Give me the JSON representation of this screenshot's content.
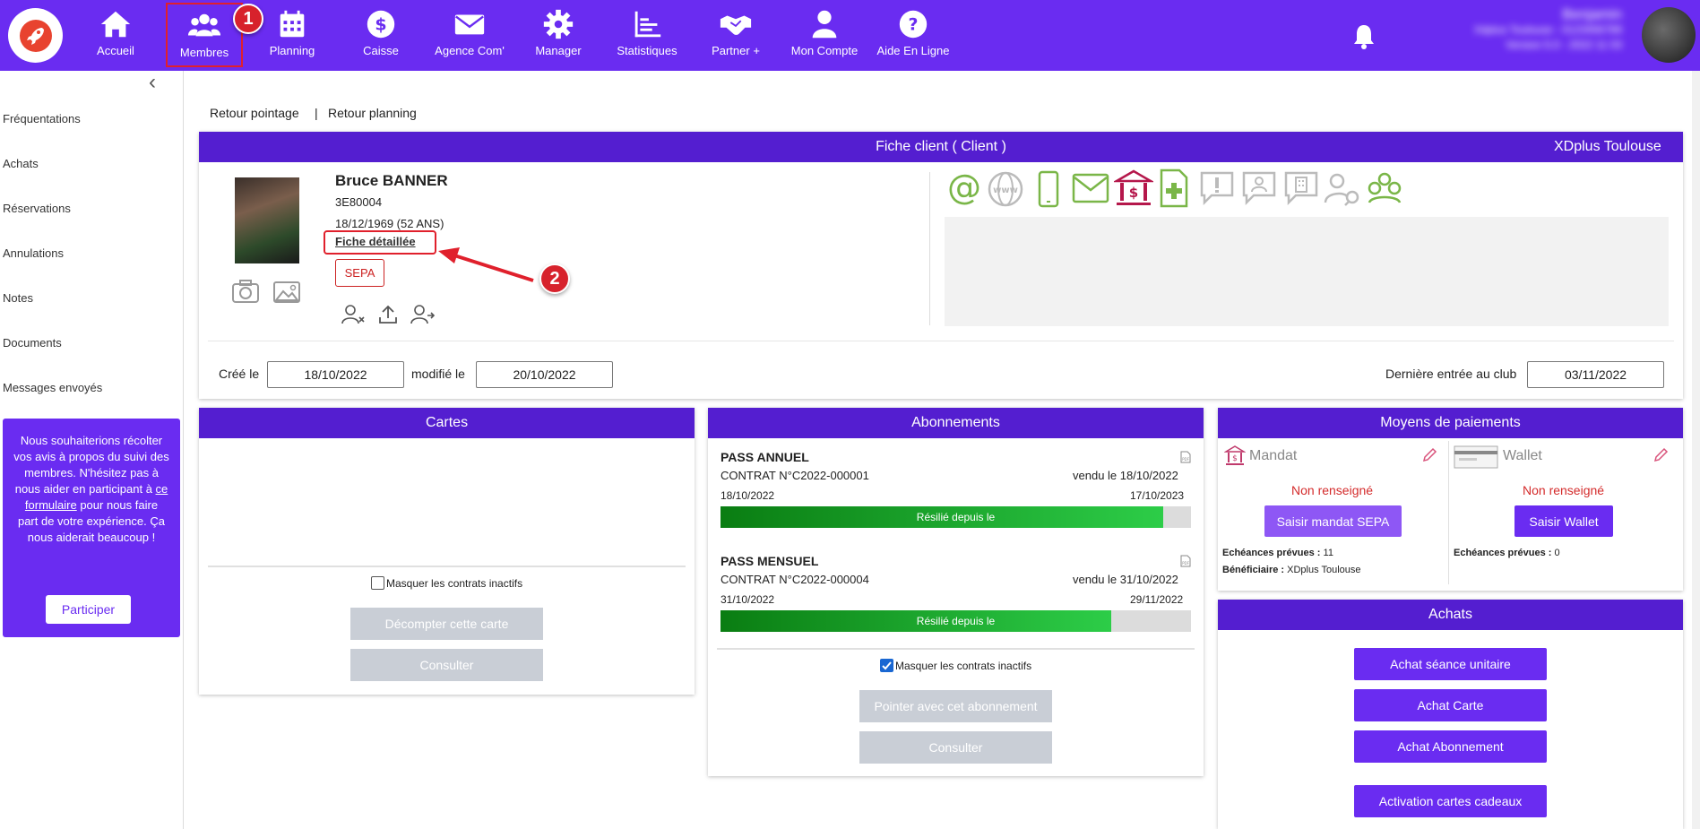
{
  "nav": {
    "items": [
      {
        "label": "Accueil",
        "icon": "home-icon"
      },
      {
        "label": "Membres",
        "icon": "users-icon"
      },
      {
        "label": "Planning",
        "icon": "calendar-icon"
      },
      {
        "label": "Caisse",
        "icon": "dollar-icon"
      },
      {
        "label": "Agence Com'",
        "icon": "envelope-icon"
      },
      {
        "label": "Manager",
        "icon": "gear-icon"
      },
      {
        "label": "Statistiques",
        "icon": "chart-icon"
      },
      {
        "label": "Partner +",
        "icon": "handshake-icon"
      },
      {
        "label": "Mon Compte",
        "icon": "user-icon"
      },
      {
        "label": "Aide En Ligne",
        "icon": "help-icon"
      }
    ],
    "badge1": "1",
    "badge2": "2"
  },
  "user": {
    "name": "Benjamin",
    "line2": "Xdplus Toulouse - 0123456789",
    "line3": "Version 5.0 - 2022 11 03"
  },
  "sidebar": {
    "items": [
      "Fréquentations",
      "Achats",
      "Réservations",
      "Annulations",
      "Notes",
      "Documents",
      "Messages envoyés"
    ],
    "feedback_pre": "Nous souhaiterions récolter vos avis à propos du suivi des membres. N'hésitez pas à nous aider en participant à ",
    "feedback_link": "ce formulaire",
    "feedback_post": " pour nous faire part de votre expérience. Ça nous aiderait beaucoup !",
    "participer": "Participer"
  },
  "links": {
    "retour_pointage": "Retour pointage",
    "sep": "|",
    "retour_planning": "Retour planning"
  },
  "fiche": {
    "title": "Fiche client ( Client )",
    "club": "XDplus Toulouse",
    "name": "Bruce BANNER",
    "id": "3E80004",
    "birth": "18/12/1969 (52 ANS)",
    "detail_link": "Fiche détaillée",
    "sepa": "SEPA",
    "created_label": "Créé le",
    "created": "18/10/2022",
    "modified_label": "modifié le",
    "modified": "20/10/2022",
    "last_entry_label": "Dernière entrée au club",
    "last_entry": "03/11/2022"
  },
  "cartes": {
    "title": "Cartes",
    "mask": "Masquer les contrats inactifs",
    "decompter": "Décompter cette carte",
    "consulter": "Consulter"
  },
  "abonnements": {
    "title": "Abonnements",
    "items": [
      {
        "name": "PASS ANNUEL",
        "contract": "CONTRAT N°C2022-000001",
        "sold": "vendu le 18/10/2022",
        "start": "18/10/2022",
        "end": "17/10/2023",
        "status": "Résilié depuis le",
        "progress": 0.94
      },
      {
        "name": "PASS MENSUEL",
        "contract": "CONTRAT N°C2022-000004",
        "sold": "vendu le 31/10/2022",
        "start": "31/10/2022",
        "end": "29/11/2022",
        "status": "Résilié depuis le",
        "progress": 0.83
      }
    ],
    "mask": "Masquer les contrats inactifs",
    "pointer": "Pointer avec cet abonnement",
    "consulter": "Consulter"
  },
  "paiements": {
    "title": "Moyens de paiements",
    "mandat": "Mandat",
    "wallet": "Wallet",
    "non1": "Non renseigné",
    "non2": "Non renseigné",
    "saisir_mandat": "Saisir mandat SEPA",
    "saisir_wallet": "Saisir Wallet",
    "echeances_label": "Echéances prévues :",
    "echeances_mandat": "11",
    "benef_label": "Bénéficiaire :",
    "benef": "XDplus Toulouse",
    "echeances_wallet": "0"
  },
  "achats": {
    "title": "Achats",
    "buttons": [
      "Achat séance unitaire",
      "Achat Carte",
      "Achat Abonnement",
      "Activation cartes cadeaux"
    ]
  },
  "colors": {
    "brand": "#6a2cf1",
    "panel_header": "#541ed0",
    "annotation_red": "#d7222c",
    "contact_green": "#7ab648",
    "bank_red": "#b5174b"
  }
}
